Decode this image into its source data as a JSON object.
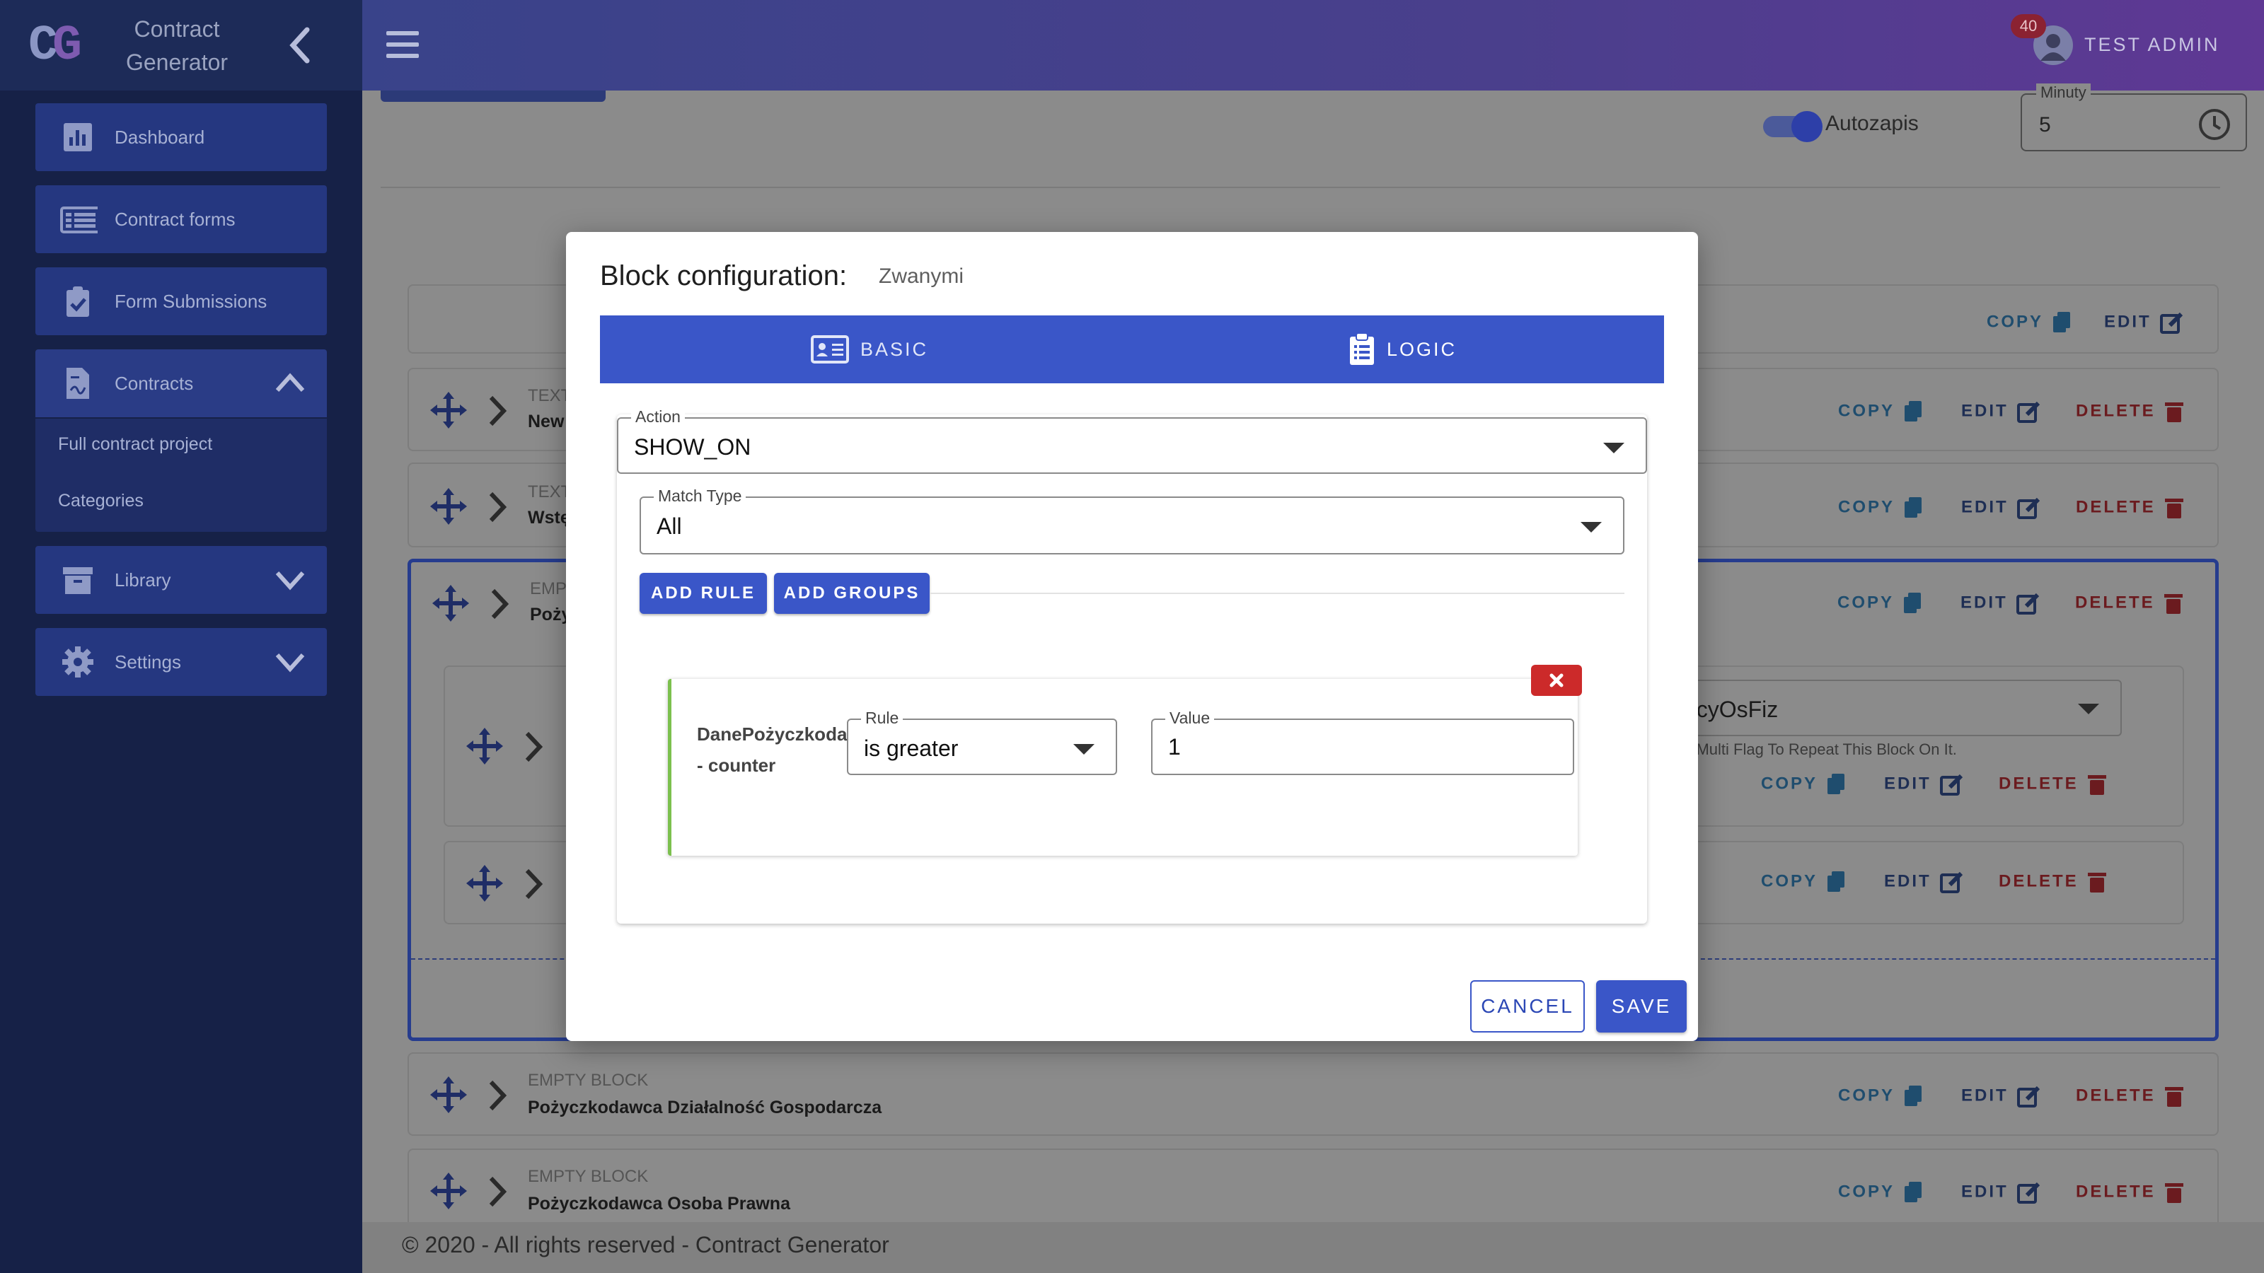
{
  "app": {
    "logo_text": "CG",
    "title": "Contract Generator"
  },
  "sidebar": {
    "items": [
      {
        "label": "Dashboard",
        "icon": "chart-icon"
      },
      {
        "label": "Contract forms",
        "icon": "list-icon"
      },
      {
        "label": "Form Submissions",
        "icon": "clipboard-check-icon"
      },
      {
        "label": "Contracts",
        "icon": "contract-icon",
        "expanded": true
      },
      {
        "label": "Library",
        "icon": "archive-icon"
      },
      {
        "label": "Settings",
        "icon": "gear-icon"
      }
    ],
    "sub_items": [
      "Full contract project",
      "Categories"
    ]
  },
  "header": {
    "user_name": "TEST ADMIN",
    "notification_count": "40"
  },
  "toolbar": {
    "autosave_label": "Autozapis",
    "autosave_on": true,
    "minutes_label": "Minuty",
    "minutes_value": "5"
  },
  "blocks": [
    {
      "type": "",
      "name": ""
    },
    {
      "type": "TEXT",
      "name": "New"
    },
    {
      "type": "TEXT",
      "name": "Wstę"
    },
    {
      "type": "EMP",
      "name": "Poży"
    },
    {
      "type": "EMPTY BLOCK",
      "name": "Pożyczkodawca Działalność Gospodarcza"
    },
    {
      "type": "EMPTY BLOCK",
      "name": "Pożyczkodawca Osoba Prawna"
    }
  ],
  "nested": {
    "select_value_partial": "dawcyOsFiz",
    "hint_partial": "p With Multi Flag To Repeat This Block On It."
  },
  "actions": {
    "copy": "COPY",
    "edit": "EDIT",
    "delete": "DELETE"
  },
  "footer": {
    "text": "© 2020 - All rights reserved - Contract Generator"
  },
  "modal": {
    "title": "Block configuration:",
    "subtitle": "Zwanymi",
    "tabs": [
      {
        "label": "BASIC",
        "icon": "id-card-icon"
      },
      {
        "label": "LOGIC",
        "icon": "clipboard-list-icon",
        "active": true
      }
    ],
    "action": {
      "label": "Action",
      "value": "SHOW_ON"
    },
    "match_type": {
      "label": "Match Type",
      "value": "All"
    },
    "add_rule_label": "ADD RULE",
    "add_groups_label": "ADD GROUPS",
    "rule": {
      "field_name": "DanePożyczkodawcyOsFiz - counter",
      "rule_label": "Rule",
      "rule_value": "is greater",
      "value_label": "Value",
      "value": "1"
    },
    "cancel_label": "CANCEL",
    "save_label": "SAVE"
  },
  "colors": {
    "primary": "#3a56c8",
    "sidebar": "#162147",
    "danger": "#cc2a2a",
    "rule_accent": "#7cc04e"
  }
}
